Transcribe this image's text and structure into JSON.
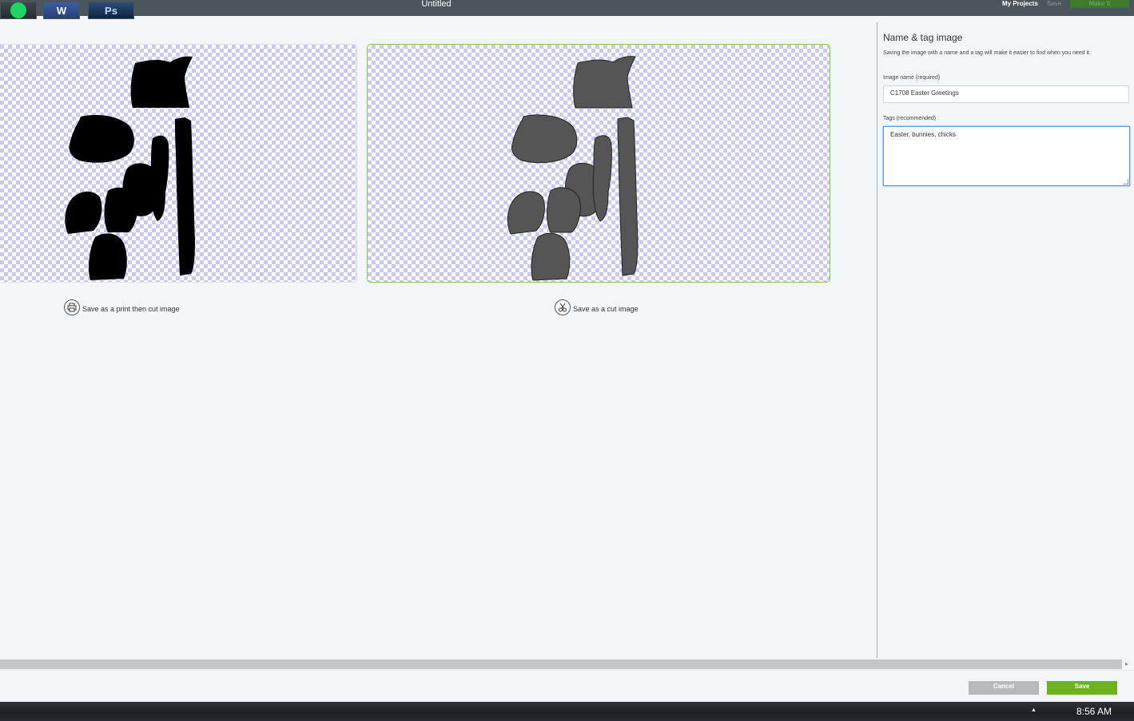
{
  "topbar": {
    "title": "Untitled",
    "my_projects": "My Projects",
    "save": "Save",
    "make_it": "Make It"
  },
  "options": [
    {
      "label": "Save as a print then cut image",
      "icon": "printer-icon"
    },
    {
      "label": "Save as a cut image",
      "icon": "scissors-icon"
    }
  ],
  "panel": {
    "title": "Name & tag image",
    "description": "Saving the image with a name and a tag will make it easier to find when you need it.",
    "name_label": "Image name (required)",
    "name_value": "C1708 Easter Greetings",
    "tags_label": "Tags (recommended)",
    "tags_value": "Easter, bunnies, chicks"
  },
  "buttons": {
    "cancel": "Cancel",
    "save": "Save"
  },
  "taskbar": {
    "apps": [
      {
        "name": "spotify-icon",
        "label": ""
      },
      {
        "name": "word-icon",
        "label": "W"
      },
      {
        "name": "photoshop-icon",
        "label": "Ps"
      }
    ],
    "time": "8:56 AM"
  },
  "colors": {
    "accent": "#6ab31f",
    "selected_border": "#8cc63f",
    "topbar": "#4b555c",
    "silhouette_print": "#000000",
    "silhouette_cut": "#555555"
  }
}
